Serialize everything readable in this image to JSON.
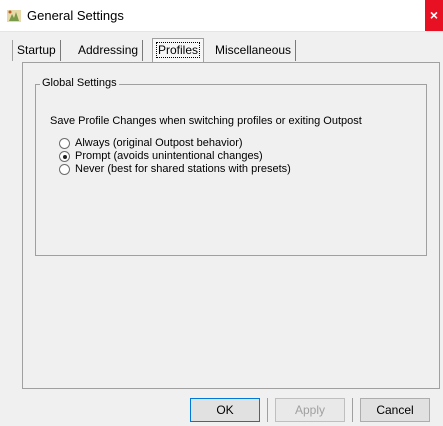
{
  "window": {
    "title": "General Settings",
    "close_glyph": "×",
    "app_icon": "tree-app-icon"
  },
  "tabs": [
    {
      "label": "Startup",
      "active": false
    },
    {
      "label": "Addressing",
      "active": false
    },
    {
      "label": "Profiles",
      "active": true
    },
    {
      "label": "Miscellaneous",
      "active": false
    }
  ],
  "group": {
    "title": "Global Settings",
    "prompt": "Save Profile Changes when switching profiles or exiting Outpost",
    "options": [
      {
        "label": "Always (original Outpost behavior)",
        "checked": false
      },
      {
        "label": "Prompt (avoids unintentional changes)",
        "checked": true
      },
      {
        "label": "Never (best for shared stations with presets)",
        "checked": false
      }
    ]
  },
  "buttons": {
    "ok": "OK",
    "apply": "Apply",
    "cancel": "Cancel"
  },
  "colors": {
    "close_bg": "#e81123",
    "dialog_bg": "#f0f0f0",
    "default_button_border": "#0078d7"
  }
}
